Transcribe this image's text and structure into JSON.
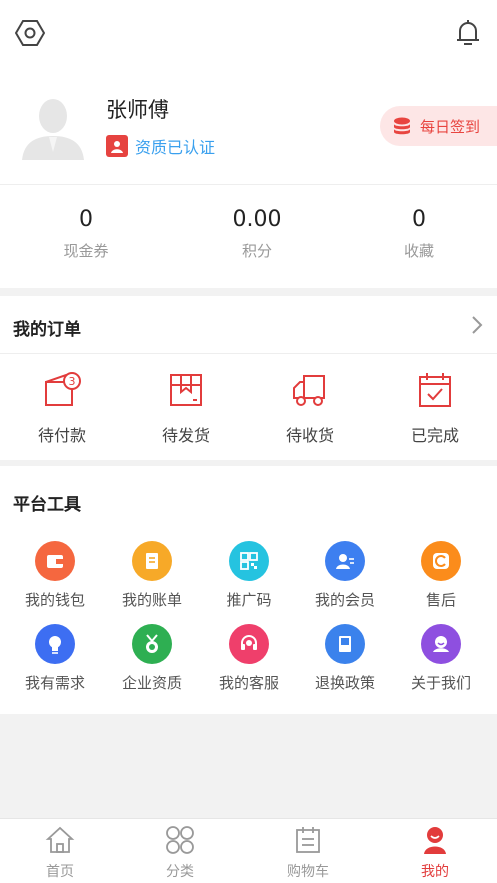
{
  "header": {
    "settings_icon": "hexagon-gear-icon",
    "notifications_icon": "bell-icon"
  },
  "profile": {
    "name": "张师傅",
    "avatar_icon": "user-avatar-placeholder",
    "certification": "资质已认证",
    "daily_signin": "每日签到"
  },
  "stats": [
    {
      "value": "0",
      "label": "现金券"
    },
    {
      "value": "0.00",
      "label": "积分"
    },
    {
      "value": "0",
      "label": "收藏"
    }
  ],
  "orders": {
    "title": "我的订单",
    "items": [
      {
        "label": "待付款",
        "icon": "wallet-icon",
        "badge": "3"
      },
      {
        "label": "待发货",
        "icon": "box-icon"
      },
      {
        "label": "待收货",
        "icon": "truck-icon"
      },
      {
        "label": "已完成",
        "icon": "calendar-check-icon"
      }
    ]
  },
  "tools": {
    "title": "平台工具",
    "items": [
      {
        "label": "我的钱包",
        "icon": "wallet-icon",
        "color": "#f5673f"
      },
      {
        "label": "我的账单",
        "icon": "bill-icon",
        "color": "#f7a928"
      },
      {
        "label": "推广码",
        "icon": "qrcode-icon",
        "color": "#25c3e0"
      },
      {
        "label": "我的会员",
        "icon": "member-icon",
        "color": "#3d7ff0"
      },
      {
        "label": "售后",
        "icon": "return-icon",
        "color": "#fb8c1b"
      },
      {
        "label": "我有需求",
        "icon": "lightbulb-icon",
        "color": "#3d6ef2"
      },
      {
        "label": "企业资质",
        "icon": "medal-icon",
        "color": "#2eaf52"
      },
      {
        "label": "我的客服",
        "icon": "headset-icon",
        "color": "#ef3f6b"
      },
      {
        "label": "退换政策",
        "icon": "book-icon",
        "color": "#3b82ec"
      },
      {
        "label": "关于我们",
        "icon": "about-icon",
        "color": "#8e4fe0"
      }
    ]
  },
  "tabbar": {
    "items": [
      {
        "label": "首页",
        "icon": "home-icon"
      },
      {
        "label": "分类",
        "icon": "category-icon"
      },
      {
        "label": "购物车",
        "icon": "cart-icon"
      },
      {
        "label": "我的",
        "icon": "profile-icon",
        "active": true
      }
    ]
  },
  "colors": {
    "accent": "#e23c3c",
    "cert_blue": "#3aa0ee"
  }
}
